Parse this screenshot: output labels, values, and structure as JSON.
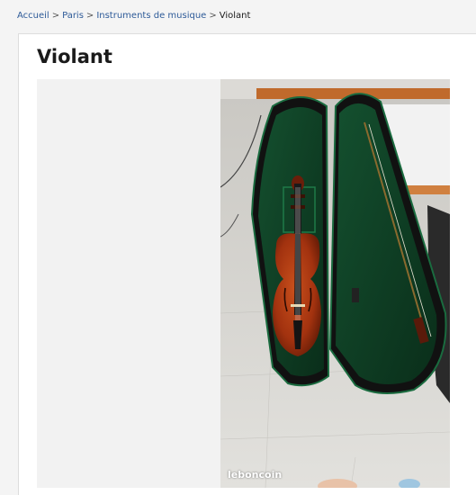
{
  "breadcrumb": {
    "items": [
      {
        "label": "Accueil"
      },
      {
        "label": "Paris"
      },
      {
        "label": "Instruments de musique"
      }
    ],
    "separator": ">",
    "current": "Violant"
  },
  "listing": {
    "title": "Violant",
    "photo": {
      "watermark": "leboncoin",
      "subject": "violin in open green-lined case with bow"
    }
  },
  "colors": {
    "link": "#2d5a98",
    "text": "#1a1a1a",
    "page_bg": "#f4f4f4",
    "gallery_bg": "#f2f2f2",
    "case_lining": "#0e3b22",
    "violin_body": "#a2320f"
  }
}
